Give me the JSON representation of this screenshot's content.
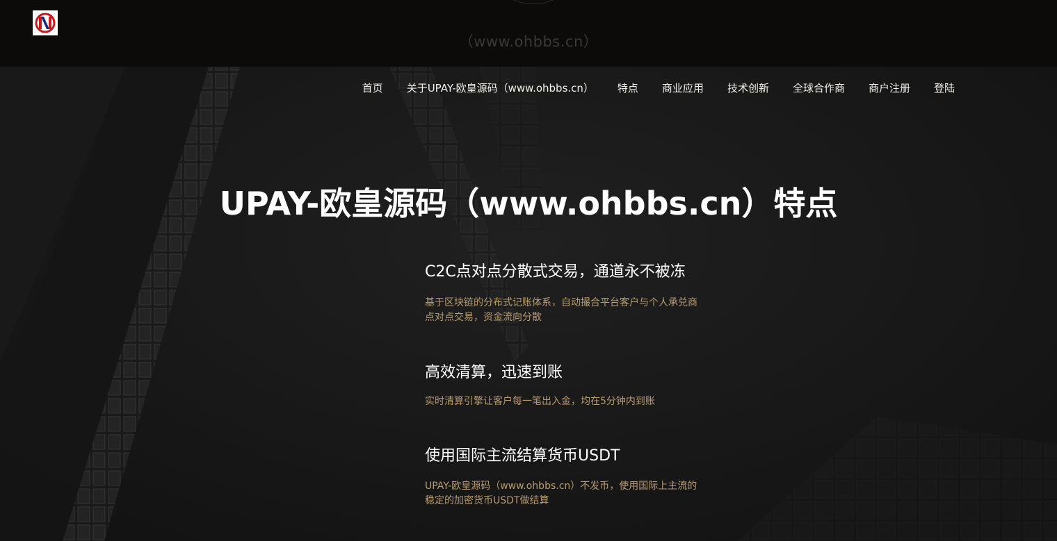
{
  "header": {
    "watermark": "（www.ohbbs.cn）",
    "logo_alt": "logo"
  },
  "nav": {
    "items": [
      {
        "label": "首页"
      },
      {
        "label": "关于UPAY-欧皇源码（www.ohbbs.cn）"
      },
      {
        "label": "特点"
      },
      {
        "label": "商业应用"
      },
      {
        "label": "技术创新"
      },
      {
        "label": "全球合作商"
      },
      {
        "label": "商户注册"
      },
      {
        "label": "登陆"
      }
    ]
  },
  "hero": {
    "title": "UPAY-欧皇源码（www.ohbbs.cn）特点"
  },
  "features": [
    {
      "title": "C2C点对点分散式交易，通道永不被冻",
      "desc": "基于区块链的分布式记账体系，自动撮合平台客户与个人承兑商点对点交易，资金流向分散"
    },
    {
      "title": "高效清算，迅速到账",
      "desc": "实时清算引擎让客户每一笔出入金，均在5分钟内到账"
    },
    {
      "title": "使用国际主流结算货币USDT",
      "desc": "UPAY-欧皇源码（www.ohbbs.cn）不发币，使用国际上主流的稳定的加密货币USDT做结算"
    }
  ],
  "colors": {
    "accent": "#b89c6f",
    "background": "#161616",
    "topbar": "#0c0b0a"
  }
}
